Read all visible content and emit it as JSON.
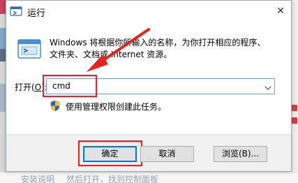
{
  "dialog": {
    "title": "运行",
    "description_line1": "Windows 将根据你所输入的名称，为你打开相应的程序、",
    "description_line2": "文件夹、文档或 Internet 资源。",
    "open_label_prefix": "打开(",
    "open_label_key": "O",
    "open_label_suffix": "):",
    "command_value": "cmd",
    "admin_text": "使用管理权限创建此任务。",
    "ok_label": "确定",
    "cancel_label": "取消",
    "browse_label": "浏览(B)...",
    "close_symbol": "✕"
  },
  "background": {
    "bottom_text_left": "安装说明",
    "bottom_text_right": "然后打开，找到控制面板"
  },
  "icons": {
    "title": "run-icon",
    "app": "run-app-icon",
    "shield": "uac-shield-icon",
    "dropdown": "chevron-down-icon",
    "close": "close-icon"
  },
  "colors": {
    "annotation": "#e8231d",
    "focus_border": "#0078d7",
    "window_bg": "#ffffff",
    "footer_bg": "#f0f0f0"
  }
}
